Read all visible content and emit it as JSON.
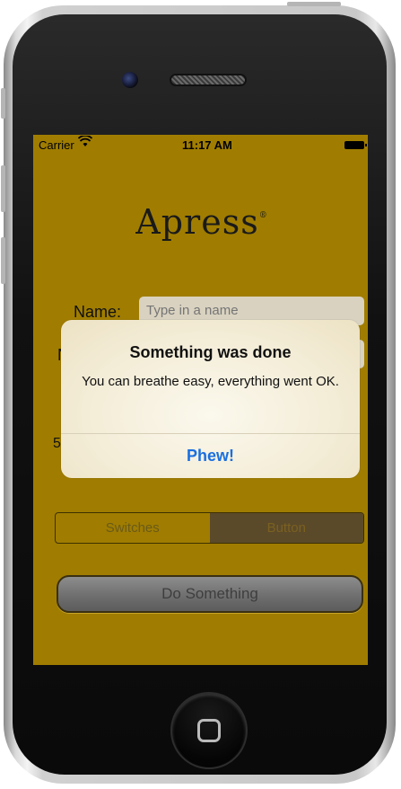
{
  "status_bar": {
    "carrier": "Carrier",
    "wifi_icon": "wifi-icon",
    "time": "11:17 AM",
    "battery_icon": "battery-icon"
  },
  "logo": {
    "text": "Apress",
    "mark": "®"
  },
  "form": {
    "name_label": "Name:",
    "name_placeholder": "Type in a name",
    "number_label_partial": "N",
    "slider_value_partial": "5"
  },
  "segmented_control": {
    "segments": [
      "Switches",
      "Button"
    ],
    "selected": "Button"
  },
  "do_something_button": {
    "label": "Do Something"
  },
  "alert": {
    "title": "Something was done",
    "message": "You can breathe easy, everything went OK.",
    "button": "Phew!"
  },
  "colors": {
    "screen_background": "#a07d00",
    "alert_button_text": "#1a6fe0"
  }
}
